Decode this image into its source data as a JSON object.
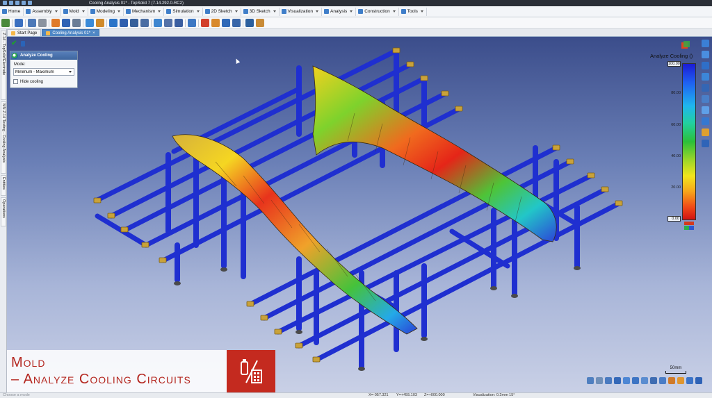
{
  "window": {
    "title": "Cooling Analysis 01* - TopSolid 7 (7.14.292.0-RC2)"
  },
  "menu": [
    {
      "label": "Home",
      "icon": "home-icon"
    },
    {
      "label": "Assembly",
      "icon": "assembly-icon"
    },
    {
      "label": "Mold",
      "icon": "mold-icon"
    },
    {
      "label": "Modeling",
      "icon": "modeling-icon"
    },
    {
      "label": "Mechanism",
      "icon": "mechanism-icon"
    },
    {
      "label": "Simulation",
      "icon": "simulation-icon"
    },
    {
      "label": "2D Sketch",
      "icon": "sketch-2d-icon"
    },
    {
      "label": "3D Sketch",
      "icon": "sketch-3d-icon"
    },
    {
      "label": "Visualization",
      "icon": "visualization-icon"
    },
    {
      "label": "Analysis",
      "icon": "analysis-icon"
    },
    {
      "label": "Construction",
      "icon": "construction-icon"
    },
    {
      "label": "Tools",
      "icon": "tools-icon"
    }
  ],
  "tabs": [
    {
      "label": "Start Page"
    },
    {
      "label": "Cooling Analysis 01*"
    }
  ],
  "side_tabs": [
    {
      "label": "Z.14 - TopSolid'Electrode"
    },
    {
      "label": "MN Z.14 Testing - Cooling Analysis"
    },
    {
      "label": "Entities"
    },
    {
      "label": "Operations"
    }
  ],
  "panel": {
    "title": "Analyze Cooling",
    "mode_label": "Mode:",
    "mode_value": "Minimum - Maximum",
    "hide_cooling_label": "Hide cooling"
  },
  "legend": {
    "title": "Analyze Cooling ()",
    "ticks": [
      "100.00",
      "80.00",
      "60.00",
      "40.00",
      "20.00",
      "0.00"
    ],
    "max_color": "#1b1bd6",
    "min_color": "#d01212"
  },
  "scale_bar": {
    "label": "50mm"
  },
  "banner": {
    "line1": "Mold",
    "line2": "– Analyze Cooling Circuits",
    "accent": "#c42a1f"
  },
  "status": {
    "message": "Choose a mode",
    "x": "X=-057.321",
    "y": "Y=+455.103",
    "z": "Z=+000.000",
    "visualization": "Visualization: 0.2mm 15°"
  },
  "colors": {
    "cooling_pipe": "#1f2fd0",
    "fitting_brass": "#c9a23a",
    "background_top": "#3b4d8b",
    "background_bottom": "#c9d0e6"
  }
}
